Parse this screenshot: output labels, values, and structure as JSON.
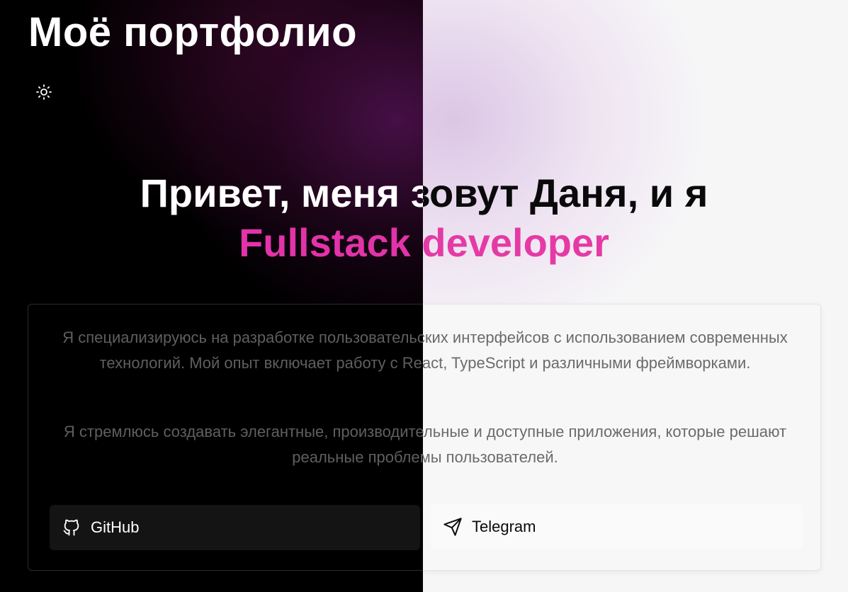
{
  "header": {
    "title": "Моё портфолио",
    "theme_toggle_icon": "sun-icon"
  },
  "hero": {
    "line1": "Привет, меня зовут Даня, и я",
    "line2": "Fullstack developer",
    "accent_color": "#e233a8"
  },
  "about": {
    "paragraph1": "Я специализируюсь на разработке пользовательских интерфейсов с использованием современных технологий. Мой опыт включает работу с React, TypeScript и различными фреймворками.",
    "paragraph2": "Я стремлюсь создавать элегантные, производительные и доступные приложения, которые решают реальные проблемы пользователей."
  },
  "links": [
    {
      "label": "GitHub",
      "icon": "github-icon"
    },
    {
      "label": "Telegram",
      "icon": "send-icon"
    }
  ],
  "theme": {
    "dark_background": "#000000",
    "light_background": "#f6f6f7"
  }
}
